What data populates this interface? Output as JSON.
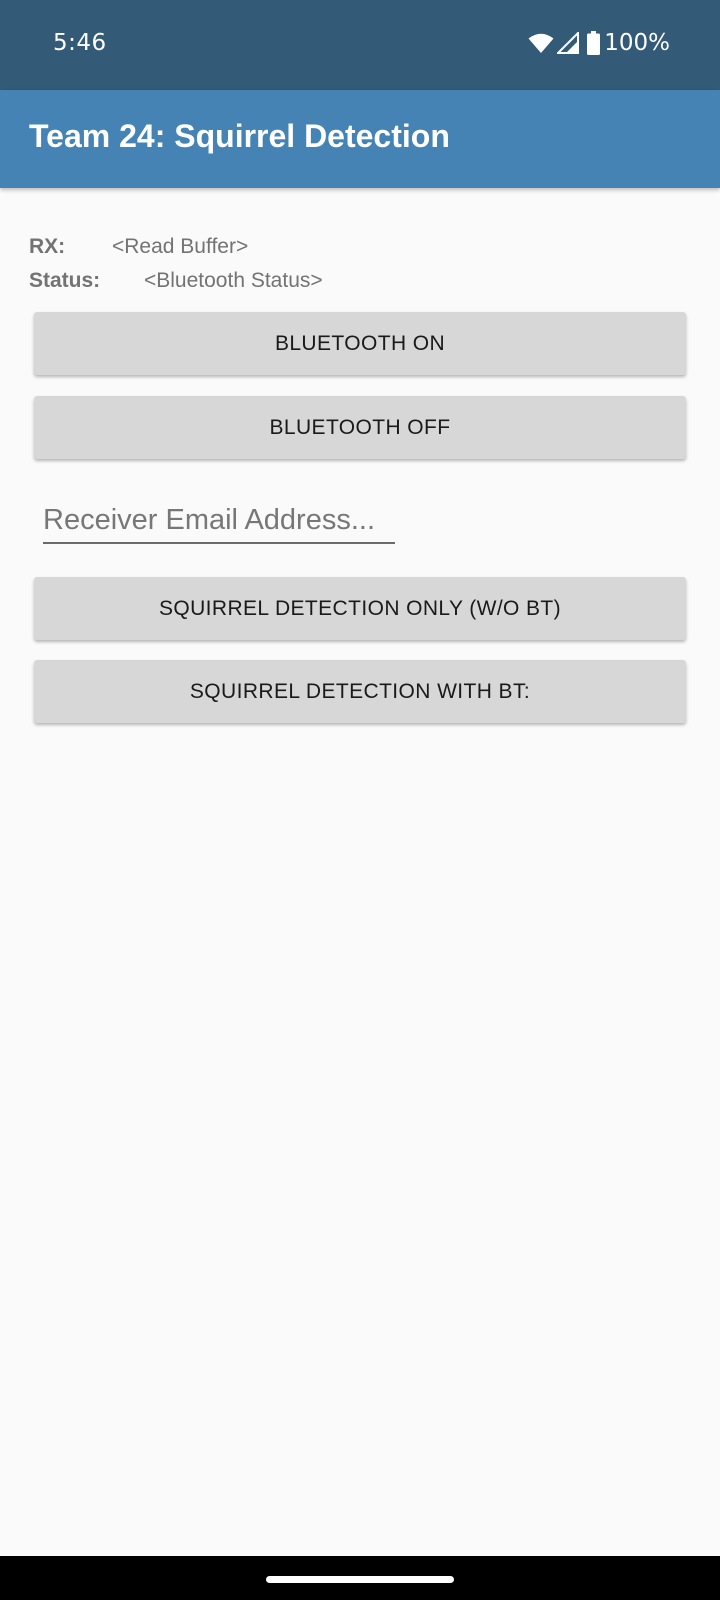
{
  "status_bar": {
    "time": "5:46",
    "battery_percent": "100%",
    "icons": [
      "wifi-icon",
      "cell-signal-icon",
      "battery-icon"
    ]
  },
  "app_bar": {
    "title": "Team 24: Squirrel Detection"
  },
  "info": {
    "rx_label": "RX:",
    "rx_value": "<Read Buffer>",
    "status_label": "Status:",
    "status_value": "<Bluetooth Status>"
  },
  "buttons": {
    "bluetooth_on": "BLUETOOTH ON",
    "bluetooth_off": "BLUETOOTH OFF",
    "detection_only": "SQUIRREL DETECTION ONLY (W/O BT)",
    "detection_with_bt": "SQUIRREL DETECTION WITH BT:"
  },
  "email": {
    "placeholder": "Receiver Email Address...",
    "value": ""
  },
  "colors": {
    "status_bar": "#335a77",
    "app_bar": "#4583b4",
    "background": "#fafafa",
    "button": "#d7d7d7"
  }
}
